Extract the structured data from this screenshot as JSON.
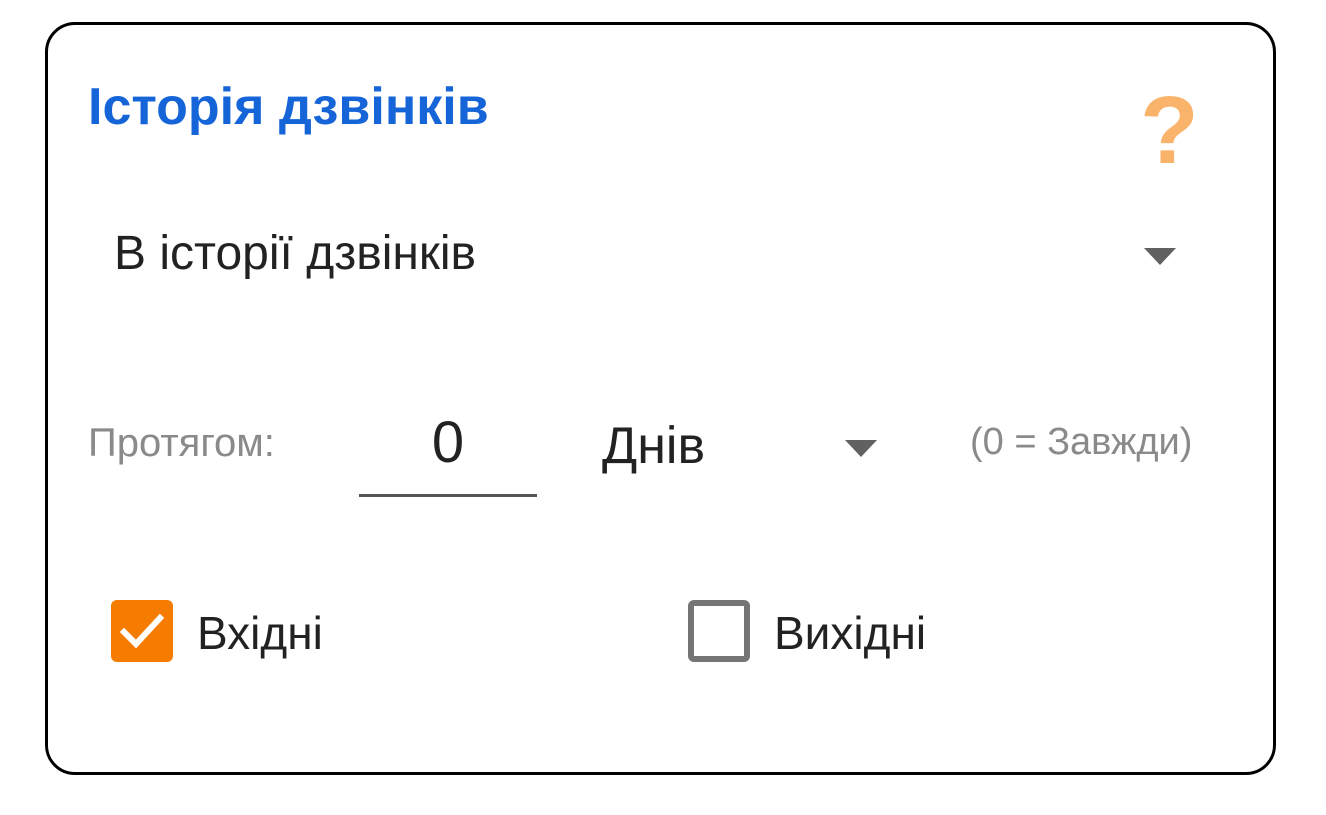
{
  "card": {
    "title": "Історія дзвінків",
    "help_icon": "question-mark-icon",
    "help_glyph": "?",
    "help_color": "#f9b36a",
    "title_color": "#1565d8"
  },
  "source_dropdown": {
    "selected": "В історії дзвінків"
  },
  "period": {
    "label": "Протягом:",
    "value": "0",
    "unit": "Днів",
    "hint": "(0 = Завжди)"
  },
  "filters": {
    "incoming": {
      "label": "Вхідні",
      "checked": true,
      "color": "#f57c00"
    },
    "outgoing": {
      "label": "Вихідні",
      "checked": false
    }
  }
}
